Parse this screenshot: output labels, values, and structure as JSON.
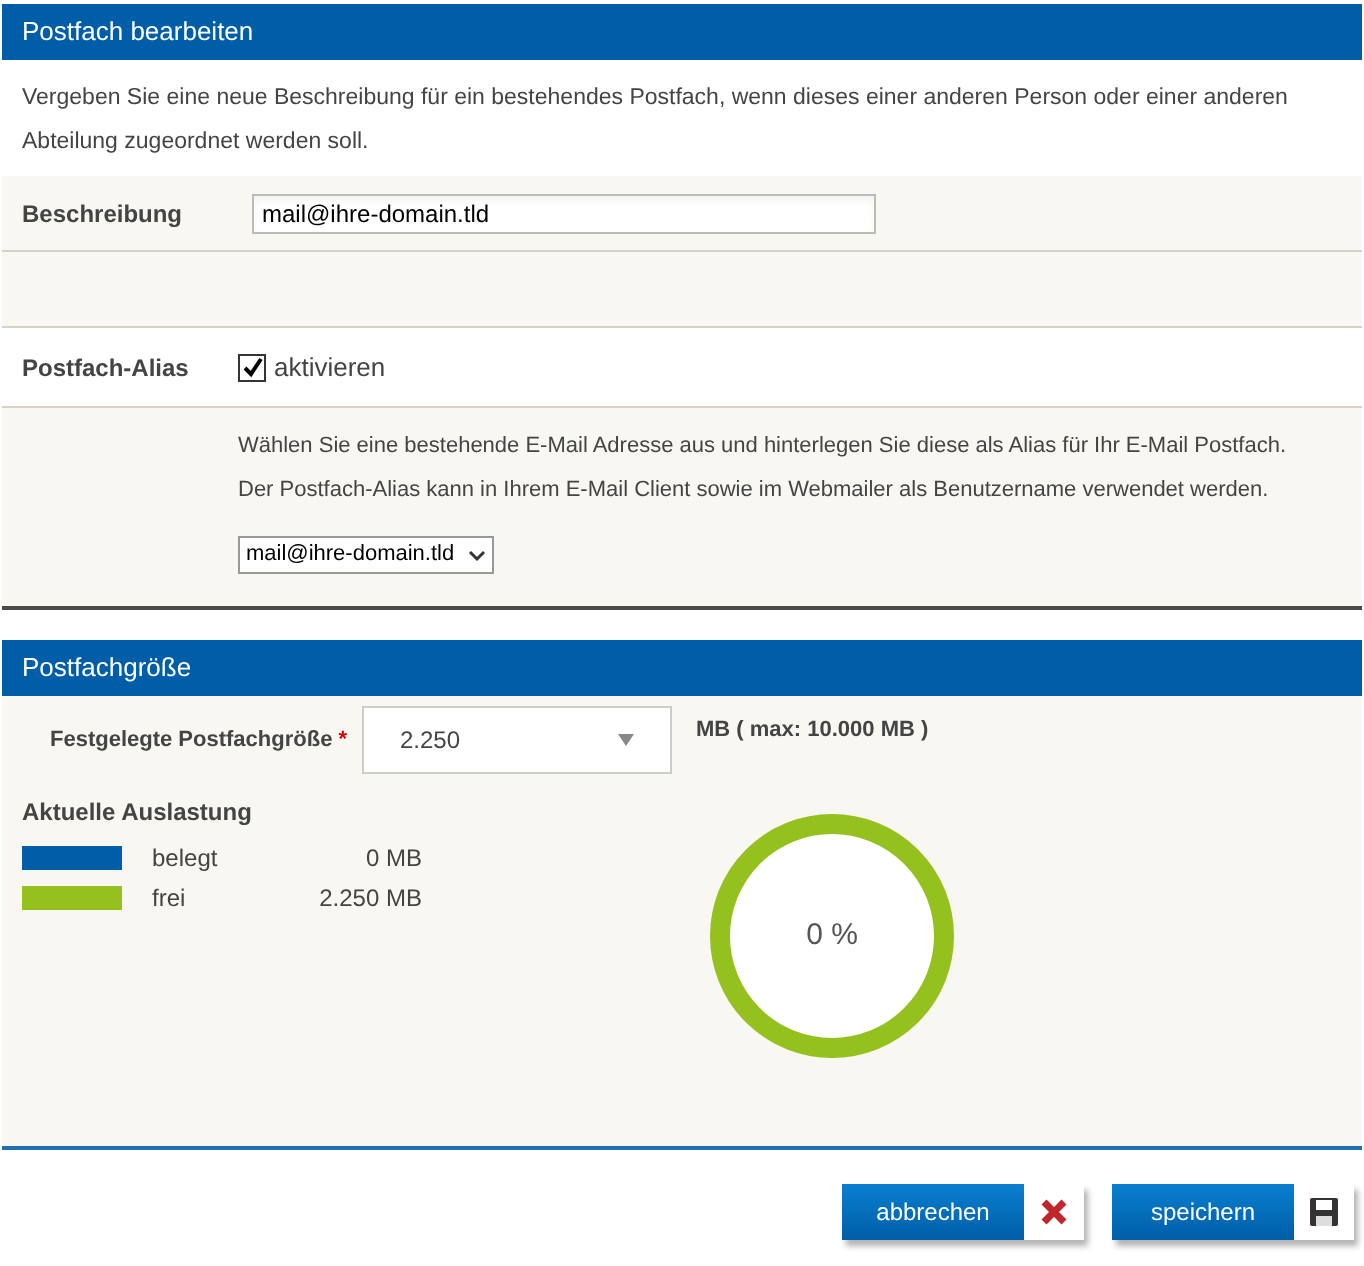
{
  "edit_section": {
    "title": "Postfach bearbeiten",
    "intro": "Vergeben Sie eine neue Beschreibung für ein bestehendes Postfach, wenn dieses einer anderen Person oder einer anderen Abteilung zugeordnet werden soll.",
    "description_field": {
      "label": "Beschreibung",
      "value": "mail@ihre-domain.tld"
    },
    "alias": {
      "label": "Postfach-Alias",
      "checkbox_label": "aktivieren",
      "checked": true,
      "help": [
        "Wählen Sie eine bestehende E-Mail Adresse aus und hinterlegen Sie diese als Alias für Ihr E-Mail Postfach.",
        "Der Postfach-Alias kann in Ihrem E-Mail Client sowie im Webmailer als Benutzername verwendet werden."
      ],
      "select_value": "mail@ihre-domain.tld"
    }
  },
  "size_section": {
    "title": "Postfachgröße",
    "size_field": {
      "label": "Festgelegte Postfachgröße",
      "required_mark": "*",
      "value": "2.250",
      "unit": "MB ( max: 10.000 MB )"
    },
    "usage": {
      "title": "Aktuelle Auslastung",
      "legend": [
        {
          "label": "belegt",
          "value": "0 MB",
          "color": "#005ea8"
        },
        {
          "label": "frei",
          "value": "2.250 MB",
          "color": "#95c11f"
        }
      ],
      "meter": {
        "reading": "0 %"
      }
    }
  },
  "buttons": [
    {
      "label": "abbrechen",
      "kind": "cancel"
    },
    {
      "label": "speichern",
      "kind": "save"
    }
  ]
}
